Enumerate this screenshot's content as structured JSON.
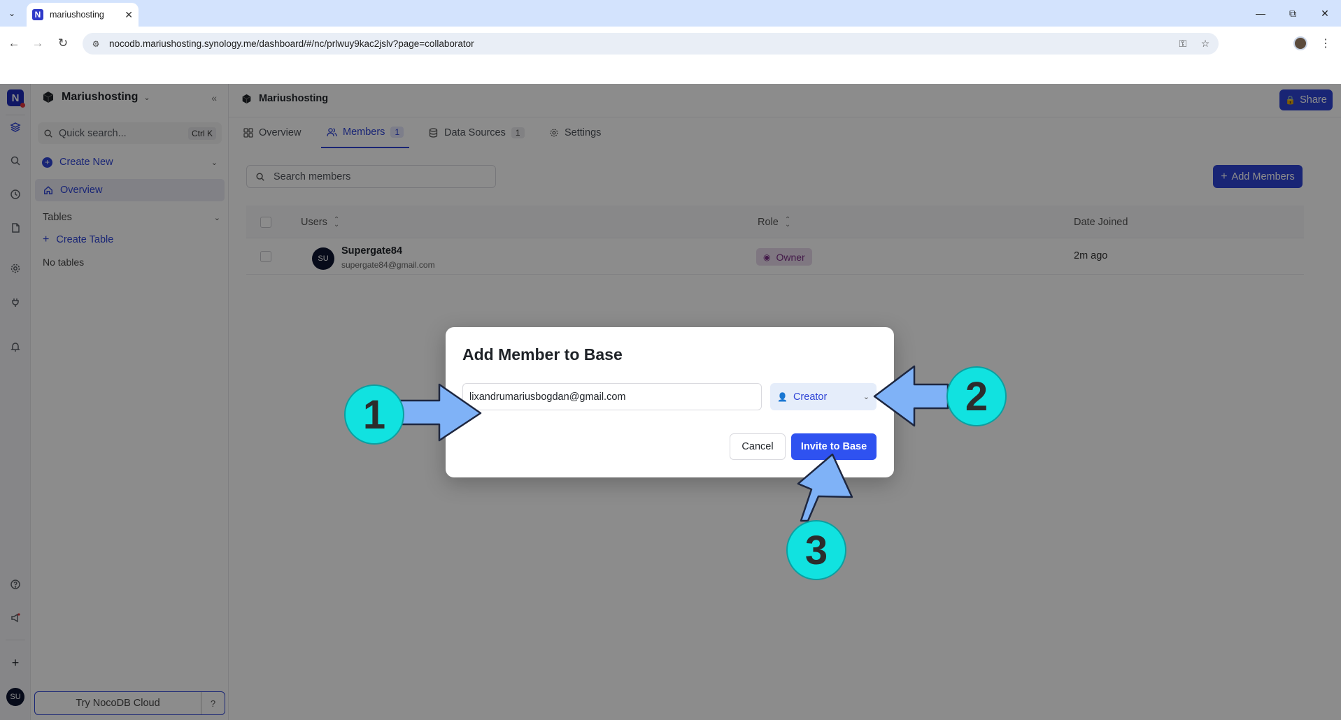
{
  "browser": {
    "tab_title": "mariushosting",
    "url": "nocodb.mariushosting.synology.me/dashboard/#/nc/prlwuy9kac2jslv?page=collaborator"
  },
  "sidebar": {
    "workspace_title": "Mariushosting",
    "quick_search_placeholder": "Quick search...",
    "quick_search_shortcut": "Ctrl K",
    "create_new_label": "Create New",
    "overview_label": "Overview",
    "tables_label": "Tables",
    "create_table_label": "Create Table",
    "no_tables_label": "No tables",
    "try_cloud_label": "Try NocoDB Cloud",
    "user_initials": "SU"
  },
  "main": {
    "title": "Mariushosting",
    "share_label": "Share",
    "tabs": [
      {
        "label": "Overview"
      },
      {
        "label": "Members",
        "count": "1"
      },
      {
        "label": "Data Sources",
        "count": "1"
      },
      {
        "label": "Settings"
      }
    ],
    "search_members_placeholder": "Search members",
    "add_members_label": "Add Members",
    "table": {
      "columns": [
        "Users",
        "Role",
        "Date Joined"
      ],
      "rows": [
        {
          "initials": "SU",
          "name": "Supergate84",
          "email": "supergate84@gmail.com",
          "role": "Owner",
          "date_joined": "2m ago"
        }
      ]
    }
  },
  "modal": {
    "title": "Add Member to Base",
    "email_value": "lixandrumariusbogdan@gmail.com",
    "role_value": "Creator",
    "cancel_label": "Cancel",
    "invite_label": "Invite to Base"
  },
  "annotations": [
    "1",
    "2",
    "3"
  ],
  "colors": {
    "accent": "#2f44d6",
    "invite_button": "#2f52f0",
    "callout_fill": "#11e2e0",
    "arrow_fill": "#7fb2f7",
    "owner_badge": "#e8d9ec"
  }
}
